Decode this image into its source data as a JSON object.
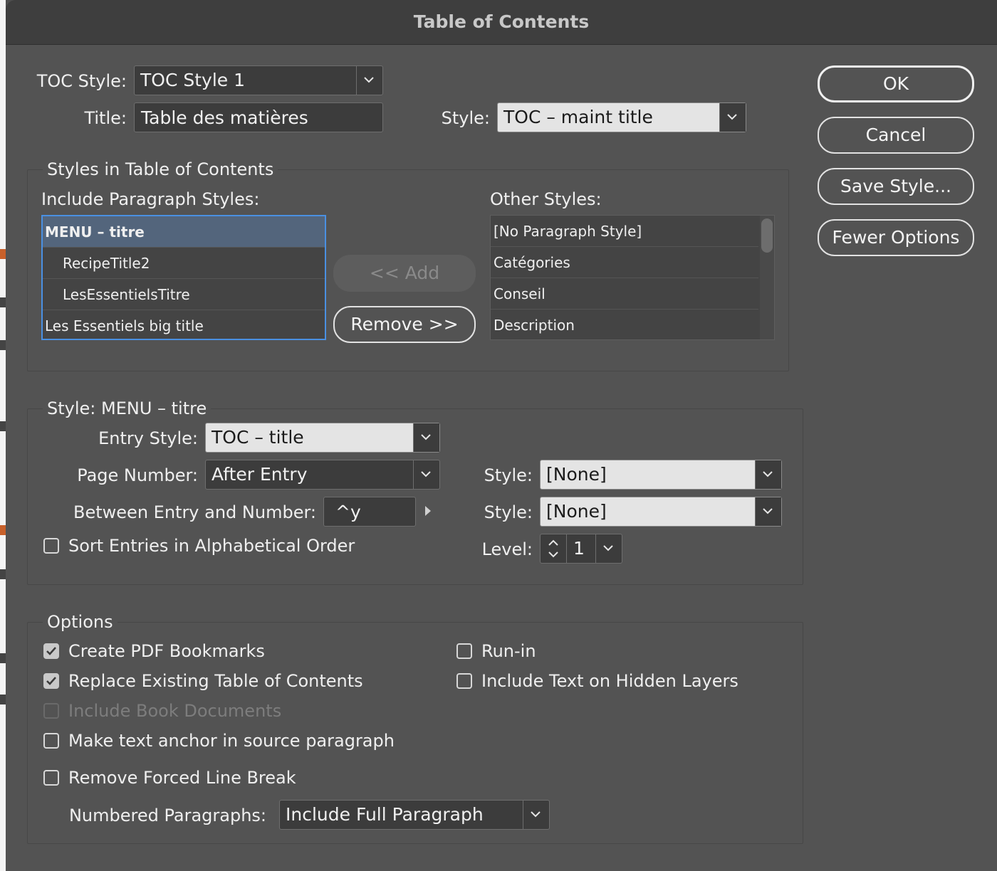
{
  "dialog": {
    "title": "Table of Contents"
  },
  "toc_style": {
    "label": "TOC Style:",
    "value": "TOC Style 1"
  },
  "title_field": {
    "label": "Title:",
    "value": "Table des matières"
  },
  "title_style": {
    "label": "Style:",
    "value": "TOC – maint title"
  },
  "buttons": {
    "ok": "OK",
    "cancel": "Cancel",
    "save_style": "Save Style...",
    "fewer_options": "Fewer Options"
  },
  "styles_group": {
    "title": "Styles in Table of Contents",
    "include_label": "Include Paragraph Styles:",
    "include_items": [
      "MENU – titre",
      "RecipeTitle2",
      "LesEssentielsTitre",
      "Les Essentiels big title"
    ],
    "other_label": "Other Styles:",
    "other_items": [
      "[No Paragraph Style]",
      "Catégories",
      "Conseil",
      "Description"
    ],
    "add": "<< Add",
    "remove": "Remove >>"
  },
  "style_group": {
    "title": "Style: MENU – titre",
    "entry_style_label": "Entry Style:",
    "entry_style_value": "TOC – title",
    "page_number_label": "Page Number:",
    "page_number_value": "After Entry",
    "between_label": "Between Entry and Number:",
    "between_value": "^y",
    "style_label_1": "Style:",
    "style_value_1": "[None]",
    "style_label_2": "Style:",
    "style_value_2": "[None]",
    "level_label": "Level:",
    "level_value": "1",
    "sort_label": "Sort Entries in Alphabetical Order",
    "sort_checked": false
  },
  "options_group": {
    "title": "Options",
    "create_pdf": "Create PDF Bookmarks",
    "replace_existing": "Replace Existing Table of Contents",
    "include_book": "Include Book Documents",
    "make_anchor": "Make text anchor in source paragraph",
    "remove_forced": "Remove Forced Line Break",
    "run_in": "Run-in",
    "include_hidden": "Include Text on Hidden Layers",
    "numbered_label": "Numbered Paragraphs:",
    "numbered_value": "Include Full Paragraph",
    "checked": {
      "create_pdf": true,
      "replace_existing": true,
      "include_book": false,
      "make_anchor": false,
      "remove_forced": false,
      "run_in": false,
      "include_hidden": false
    }
  },
  "colors": {
    "dialog_bg": "#535353",
    "titlebar_bg": "#3e3e3e",
    "selection": "#53657c",
    "focus_ring": "#4a90e2"
  }
}
